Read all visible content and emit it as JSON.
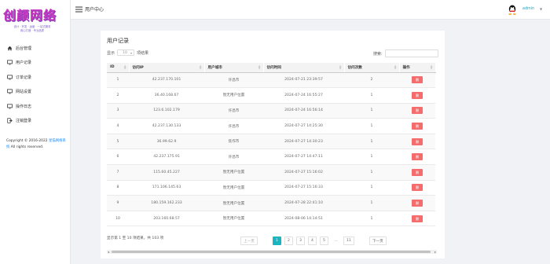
{
  "brand": {
    "logo_title": "创颜网络",
    "logo_sub1": "设计 · 开发 · 运营 · 一站式服务",
    "logo_sub2": "用心打造 · 专业品质"
  },
  "sidebar": {
    "items": [
      {
        "label": "后台管理",
        "icon": "home-icon"
      },
      {
        "label": "用户记录",
        "icon": "monitor-icon"
      },
      {
        "label": "订单记录",
        "icon": "monitor-icon"
      },
      {
        "label": "网站设置",
        "icon": "monitor-icon"
      },
      {
        "label": "操作日志",
        "icon": "monitor-icon"
      },
      {
        "label": "注销登录",
        "icon": "logout-icon"
      }
    ],
    "copyright_prefix": "Copyright © 2016-2022 ",
    "copyright_link": "星猫网络系统",
    "copyright_suffix": " All rights reserved."
  },
  "topbar": {
    "title": "用户中心",
    "user": "admin",
    "caret": "▼"
  },
  "card": {
    "title": "用户记录",
    "length_prefix": "显示",
    "length_value": "10",
    "length_suffix": "项结果",
    "search_label": "搜索:",
    "info": "显示第 1 至 10 项结果，共 103 项"
  },
  "table": {
    "headers": [
      "ID",
      "访问IP",
      "用户城市",
      "访问时间",
      "访问次数",
      "操作"
    ],
    "delete_label": "删",
    "rows": [
      {
        "id": "1",
        "ip": "42.237.170.101",
        "city": "许昌市",
        "time": "2024-07-21 23:39:57",
        "visits": "2"
      },
      {
        "id": "2",
        "ip": "36.40.168.67",
        "city": "暂无用户位置",
        "time": "2024-07-24 16:55:27",
        "visits": "1"
      },
      {
        "id": "3",
        "ip": "123.6.102.179",
        "city": "许昌市",
        "time": "2024-07-24 16:56:14",
        "visits": "1"
      },
      {
        "id": "4",
        "ip": "42.237.130.133",
        "city": "许昌市",
        "time": "2024-07-27 14:25:30",
        "visits": "1"
      },
      {
        "id": "5",
        "ip": "36.99.62.9",
        "city": "焦作市",
        "time": "2024-07-27 14:30:23",
        "visits": "1"
      },
      {
        "id": "6",
        "ip": "42.237.175.91",
        "city": "许昌市",
        "time": "2024-07-27 14:47:11",
        "visits": "1"
      },
      {
        "id": "7",
        "ip": "115.60.45.227",
        "city": "暂无用户位置",
        "time": "2024-07-27 15:16:02",
        "visits": "1"
      },
      {
        "id": "8",
        "ip": "171.106.145.63",
        "city": "暂无用户位置",
        "time": "2024-07-27 15:16:33",
        "visits": "1"
      },
      {
        "id": "9",
        "ip": "180.159.162.233",
        "city": "暂无用户位置",
        "time": "2024-07-28 22:41:10",
        "visits": "1"
      },
      {
        "id": "10",
        "ip": "203.160.68.57",
        "city": "暂无用户位置",
        "time": "2024-08-06 14:14:51",
        "visits": "1"
      }
    ]
  },
  "pagination": {
    "prev": "上一页",
    "pages": [
      "1",
      "2",
      "3",
      "4",
      "5"
    ],
    "ellipsis": "…",
    "last": "11",
    "next": "下一页",
    "active": "1"
  },
  "colors": {
    "delete": "#f56c6c",
    "pager_active": "#1ab5c0",
    "brand": "#c639c0"
  }
}
